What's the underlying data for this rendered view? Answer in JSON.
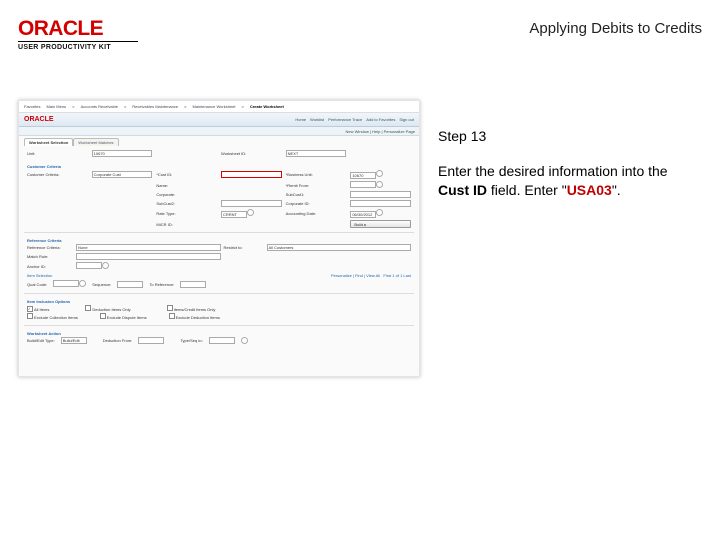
{
  "header": {
    "logo": "ORACLE",
    "logo_sub": "USER PRODUCTIVITY KIT",
    "title": "Applying Debits to Credits"
  },
  "side": {
    "step": "Step 13",
    "instr_pre": "Enter the desired information into the ",
    "instr_field": "Cust ID",
    "instr_mid": " field. Enter \"",
    "instr_val": "USA03",
    "instr_post": "\"."
  },
  "app": {
    "top": {
      "items": [
        "Favorites",
        "Main Menu",
        "Accounts Receivable",
        "Receivables Maintenance",
        "Maintenance Worksheet",
        "Create Worksheet"
      ],
      "selidx": 5
    },
    "oracle": "ORACLE",
    "menutabs": [
      "Home",
      "Worklist",
      "Performance Trace",
      "Add to Favorites",
      "Sign out"
    ],
    "subbar": "New Window | Help | Personalize Page",
    "tabs": [
      "Worksheet Selection",
      "Worksheet Matches"
    ],
    "ws": {
      "unit_l": "Unit:",
      "unit_v": "10670",
      "wsid_l": "Worksheet ID:",
      "wsid_v": "NEXT"
    },
    "cust_h": "Customer Criteria",
    "cust": {
      "crit_l": "Customer Criteria:",
      "crit_v": "Corporate Cust",
      "custid_l": "*Cust ID:",
      "custid_v": "",
      "bu_l": "*Business Unit:",
      "bu_v": "10670",
      "corp_l": "Corporate:",
      "name_l": "Name:",
      "subid_l": "SubCust1:",
      "subid2_l": "SubCust2:",
      "remit_l": "*Remit From:",
      "remit_v": "",
      "corpid_l": "Corporate ID:",
      "mcr_l": "MICR ID:",
      "rate_l": "Rate Type:",
      "rate_v": "CRRNT",
      "date_l": "Accounting Date:",
      "date_v": "06/30/2012",
      "build_btn": "Build ▸"
    },
    "ref_h": "Reference Criteria",
    "ref": {
      "rc_l": "Reference Criteria:",
      "rc_v": "None",
      "restrict_l": "Restrict to:",
      "restrict_v": "All Customers",
      "match_l": "Match Rule:",
      "anchor_l": "Anchor ID:",
      "items_h": "Item Selection",
      "pers": "Personalize | Find | View All",
      "range": "First 1 of 1 Last",
      "qual_l": "Qual Code:",
      "seq_l": "Sequence:",
      "toref_l": "To Reference:"
    },
    "inc_h": "Item Inclusion Options",
    "inc": {
      "all": "All Items",
      "ded": "Deduction Items Only",
      "items_cr": "Items/Credit Items Only",
      "ex_col": "Exclude Collection Items",
      "ex_dis": "Exclude Dispute Items",
      "ex_ded": "Exclude Deduction Items"
    },
    "wa_h": "Worksheet Action",
    "wa": {
      "build_l": "Build/Edit Type:",
      "build_v": "Build/Edit",
      "ded_from_l": "Deduction From:",
      "ded_to_l": "Type/Seq to:"
    }
  }
}
